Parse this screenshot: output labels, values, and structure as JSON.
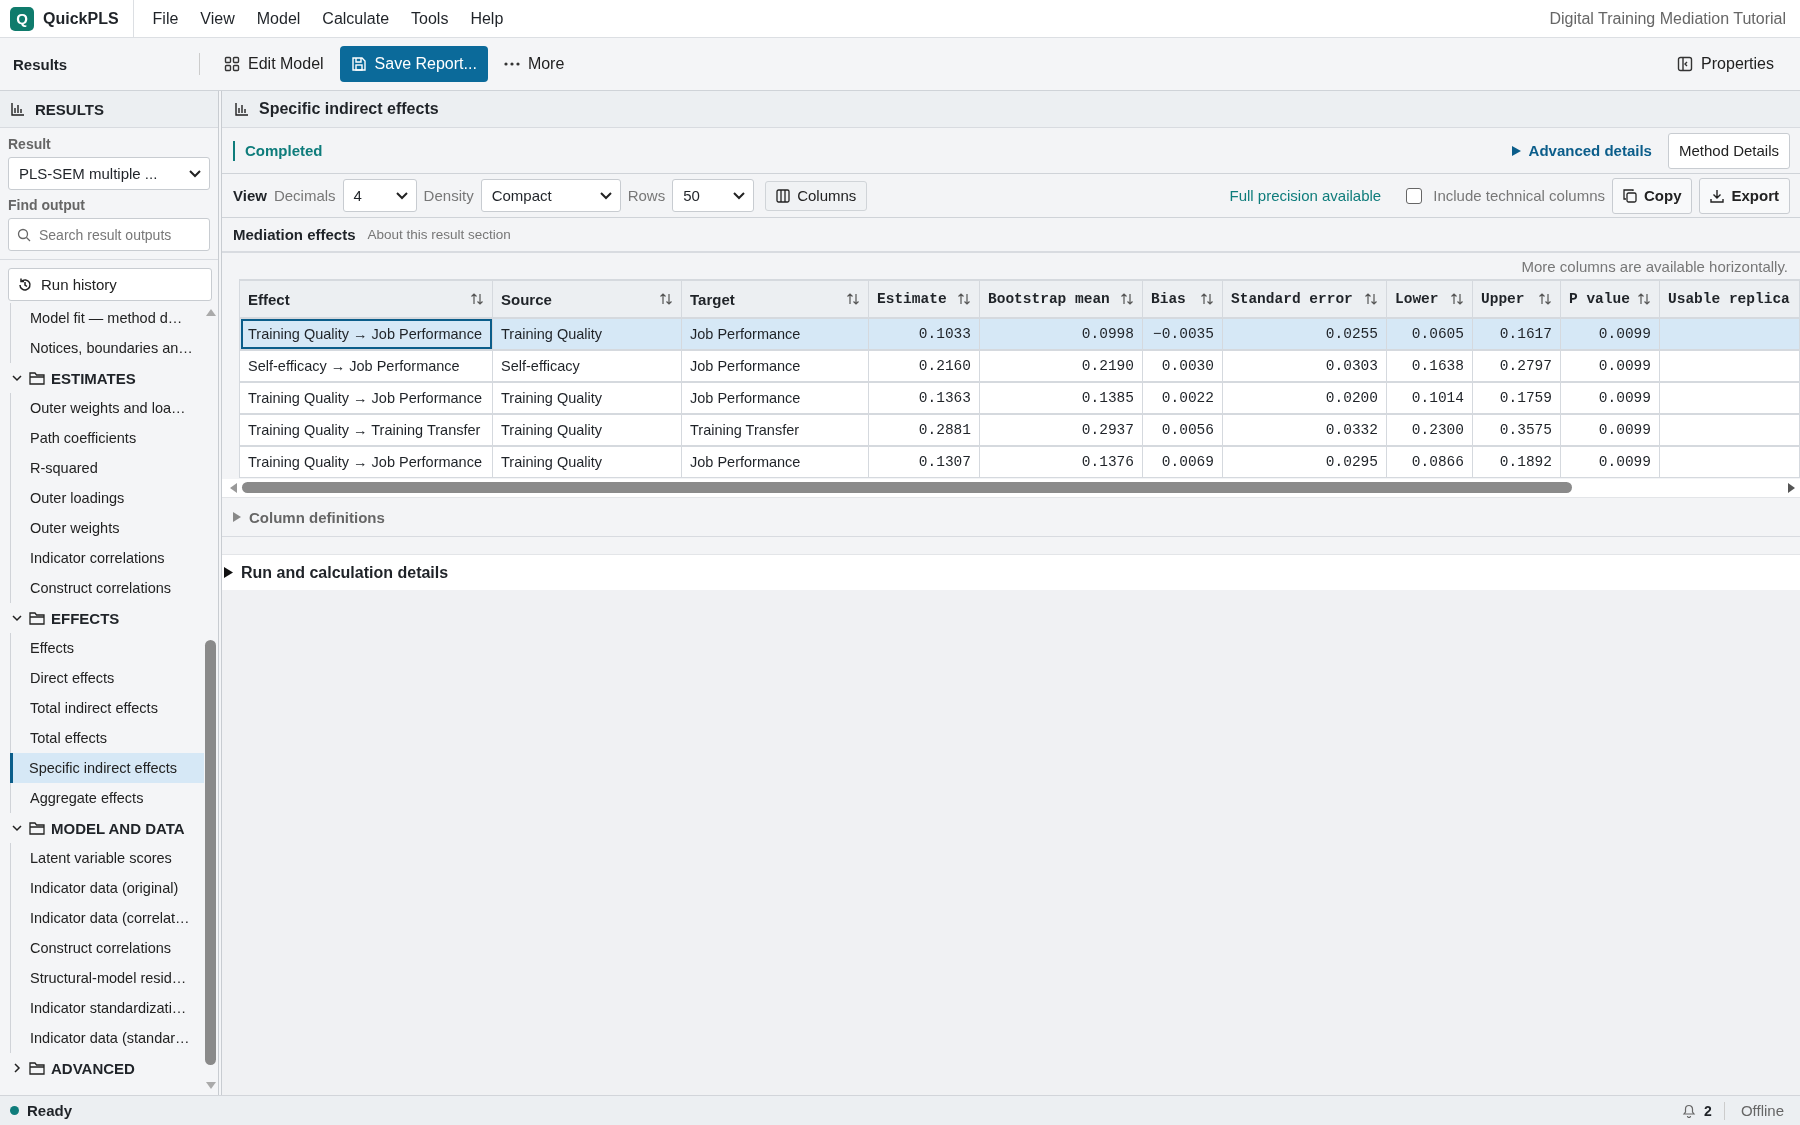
{
  "app": {
    "name": "QuickPLS",
    "logo": "Q",
    "project": "Digital Training Mediation Tutorial"
  },
  "menu": [
    "File",
    "View",
    "Model",
    "Calculate",
    "Tools",
    "Help"
  ],
  "toolbar": {
    "title": "Results",
    "buttons": [
      {
        "label": "Edit Model",
        "kind": "grid"
      },
      {
        "label": "Save Report...",
        "kind": "save"
      },
      {
        "label": "More",
        "kind": "more"
      }
    ],
    "properties": "Properties"
  },
  "sidebar": {
    "title": "RESULTS",
    "result_label": "Result",
    "result_value": "PLS-SEM multiple ...",
    "find_label": "Find output",
    "search_placeholder": "Search result outputs",
    "history": "Run history",
    "tree": [
      {
        "kind": "item",
        "label": "Model fit — method d…",
        "selected": false
      },
      {
        "kind": "item",
        "label": "Notices, boundaries an…",
        "selected": false
      },
      {
        "kind": "folder",
        "label": "ESTIMATES",
        "expanded": true,
        "children": [
          {
            "label": "Outer weights and loa…",
            "selected": false
          },
          {
            "label": "Path coefficients",
            "selected": false
          },
          {
            "label": "R-squared",
            "selected": false
          },
          {
            "label": "Outer loadings",
            "selected": false
          },
          {
            "label": "Outer weights",
            "selected": false
          },
          {
            "label": "Indicator correlations",
            "selected": false
          },
          {
            "label": "Construct correlations",
            "selected": false
          }
        ]
      },
      {
        "kind": "folder",
        "label": "EFFECTS",
        "expanded": true,
        "children": [
          {
            "label": "Effects",
            "selected": false
          },
          {
            "label": "Direct effects",
            "selected": false
          },
          {
            "label": "Total indirect effects",
            "selected": false
          },
          {
            "label": "Total effects",
            "selected": false
          },
          {
            "label": "Specific indirect effects",
            "selected": true
          },
          {
            "label": "Aggregate effects",
            "selected": false
          }
        ]
      },
      {
        "kind": "folder",
        "label": "MODEL AND DATA",
        "expanded": true,
        "children": [
          {
            "label": "Latent variable scores",
            "selected": false
          },
          {
            "label": "Indicator data (original)",
            "selected": false
          },
          {
            "label": "Indicator data (correlat…",
            "selected": false
          },
          {
            "label": "Construct correlations",
            "selected": false
          },
          {
            "label": "Structural-model resid…",
            "selected": false
          },
          {
            "label": "Indicator standardizati…",
            "selected": false
          },
          {
            "label": "Indicator data (standar…",
            "selected": false
          }
        ]
      },
      {
        "kind": "folder",
        "label": "ADVANCED",
        "expanded": false
      }
    ]
  },
  "content": {
    "title": "Specific indirect effects",
    "status": "Completed",
    "advanced": "Advanced details",
    "method_button": "Method Details",
    "view": {
      "label": "View",
      "decimals_label": "Decimals",
      "decimals": "4",
      "density_label": "Density",
      "density": "Compact",
      "rows_label": "Rows",
      "rows": "50",
      "columns_button": "Columns",
      "precision": "Full precision available",
      "include_technical": {
        "label": "Include technical columns",
        "checked": false
      },
      "copy": "Copy",
      "export": "Export"
    },
    "section": {
      "title": "Mediation effects",
      "about": "About this result section"
    },
    "hint": "More columns are available horizontally.",
    "table": {
      "columns": [
        {
          "label": "Effect",
          "kind": "text"
        },
        {
          "label": "Source",
          "kind": "text"
        },
        {
          "label": "Target",
          "kind": "text"
        },
        {
          "label": "Estimate",
          "kind": "num"
        },
        {
          "label": "Bootstrap mean",
          "kind": "num"
        },
        {
          "label": "Bias",
          "kind": "num"
        },
        {
          "label": "Standard error",
          "kind": "num"
        },
        {
          "label": "Lower",
          "kind": "num"
        },
        {
          "label": "Upper",
          "kind": "num"
        },
        {
          "label": "P value",
          "kind": "num"
        },
        {
          "label": "Usable replica",
          "kind": "cut"
        }
      ],
      "rows": [
        {
          "selected": true,
          "cells": [
            "Training Quality → Job Performance",
            "Training Quality",
            "Job Performance",
            "0.1033",
            "0.0998",
            "−0.0035",
            "0.0255",
            "0.0605",
            "0.1617",
            "0.0099"
          ]
        },
        {
          "selected": false,
          "cells": [
            "Self-efficacy → Job Performance",
            "Self-efficacy",
            "Job Performance",
            "0.2160",
            "0.2190",
            "0.0030",
            "0.0303",
            "0.1638",
            "0.2797",
            "0.0099"
          ]
        },
        {
          "selected": false,
          "cells": [
            "Training Quality → Job Performance",
            "Training Quality",
            "Job Performance",
            "0.1363",
            "0.1385",
            "0.0022",
            "0.0200",
            "0.1014",
            "0.1759",
            "0.0099"
          ]
        },
        {
          "selected": false,
          "cells": [
            "Training Quality → Training Transfer",
            "Training Quality",
            "Training Transfer",
            "0.2881",
            "0.2937",
            "0.0056",
            "0.0332",
            "0.2300",
            "0.3575",
            "0.0099"
          ]
        },
        {
          "selected": false,
          "cells": [
            "Training Quality → Job Performance",
            "Training Quality",
            "Job Performance",
            "0.1307",
            "0.1376",
            "0.0069",
            "0.0295",
            "0.0866",
            "0.1892",
            "0.0099"
          ]
        }
      ]
    },
    "column_definitions": "Column definitions",
    "run_details": "Run and calculation details"
  },
  "status_bar": {
    "state": "Ready",
    "notifications": "2",
    "connection": "Offline"
  }
}
